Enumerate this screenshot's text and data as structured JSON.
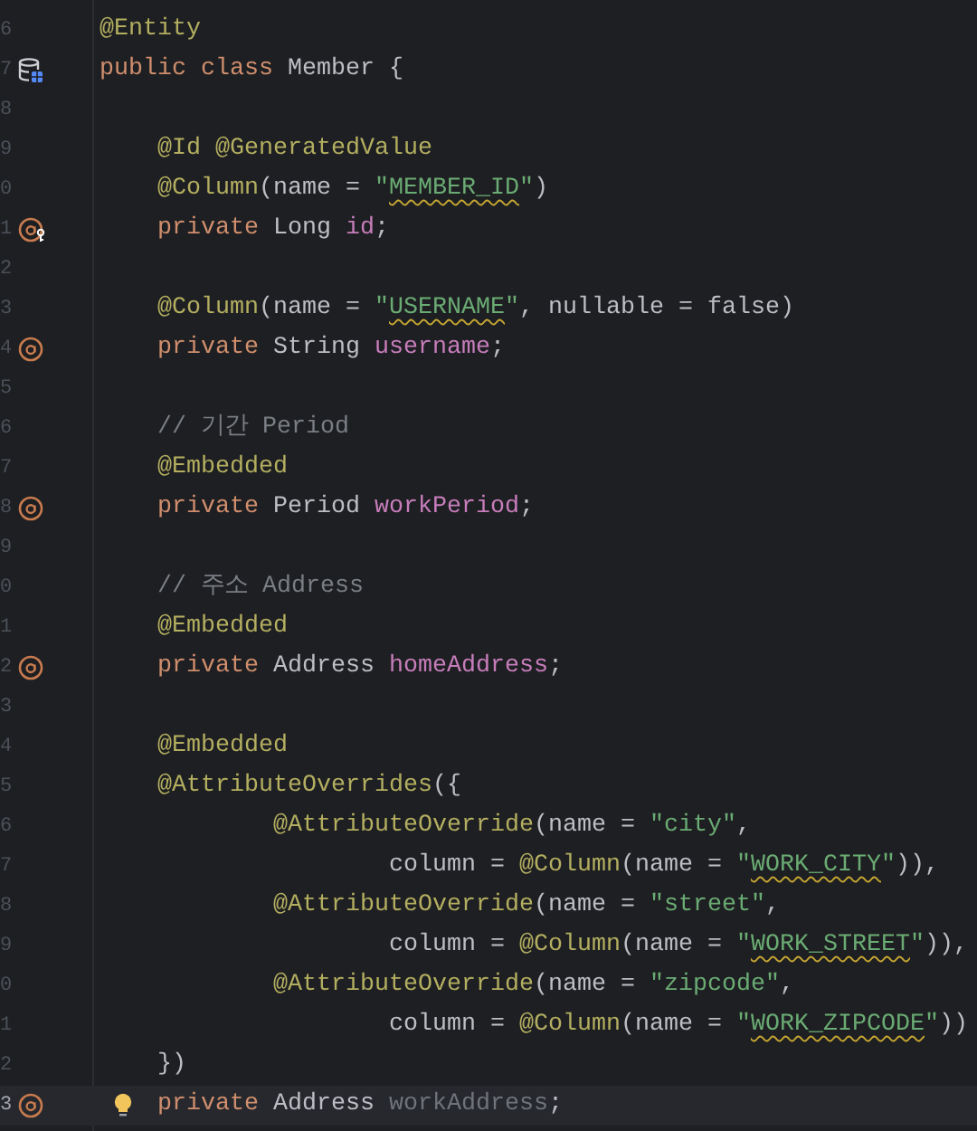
{
  "editor": {
    "lines": [
      {
        "number": "6",
        "kind": "top",
        "tokens": [
          {
            "kind": "annotation",
            "text": "@Entity"
          }
        ]
      },
      {
        "number": "7",
        "kind": "top",
        "gutter_marker": {
          "kind": "entity"
        },
        "tokens": [
          {
            "kind": "keyword",
            "text": "public class "
          },
          {
            "kind": "plain",
            "text": "Member {"
          }
        ]
      },
      {
        "number": "8",
        "kind": "blank"
      },
      {
        "number": "9",
        "kind": "member",
        "tokens": [
          {
            "kind": "annotation",
            "text": "@Id @GeneratedValue"
          }
        ]
      },
      {
        "number": "0",
        "kind": "member",
        "tokens": [
          {
            "kind": "annotation",
            "text": "@Column"
          },
          {
            "kind": "plain",
            "text": "(name = "
          },
          {
            "kind": "string",
            "text": "\""
          },
          {
            "kind": "string_warning",
            "text": "MEMBER_ID"
          },
          {
            "kind": "string",
            "text": "\""
          },
          {
            "kind": "plain",
            "text": ")"
          }
        ]
      },
      {
        "number": "1",
        "kind": "member",
        "gutter_marker": {
          "kind": "id_field"
        },
        "tokens": [
          {
            "kind": "keyword",
            "text": "private "
          },
          {
            "kind": "plain",
            "text": "Long "
          },
          {
            "kind": "field",
            "text": "id"
          },
          {
            "kind": "plain",
            "text": ";"
          }
        ]
      },
      {
        "number": "2",
        "kind": "blank"
      },
      {
        "number": "3",
        "kind": "member",
        "tokens": [
          {
            "kind": "annotation",
            "text": "@Column"
          },
          {
            "kind": "plain",
            "text": "(name = "
          },
          {
            "kind": "string",
            "text": "\""
          },
          {
            "kind": "string_warning",
            "text": "USERNAME"
          },
          {
            "kind": "string",
            "text": "\""
          },
          {
            "kind": "plain",
            "text": ", nullable = false)"
          }
        ]
      },
      {
        "number": "4",
        "kind": "member",
        "gutter_marker": {
          "kind": "field"
        },
        "tokens": [
          {
            "kind": "keyword",
            "text": "private "
          },
          {
            "kind": "plain",
            "text": "String "
          },
          {
            "kind": "field",
            "text": "username"
          },
          {
            "kind": "plain",
            "text": ";"
          }
        ]
      },
      {
        "number": "5",
        "kind": "blank"
      },
      {
        "number": "6",
        "kind": "member",
        "tokens": [
          {
            "kind": "comment",
            "text": "// 기간 Period"
          }
        ]
      },
      {
        "number": "7",
        "kind": "member",
        "tokens": [
          {
            "kind": "annotation",
            "text": "@Embedded"
          }
        ]
      },
      {
        "number": "8",
        "kind": "member",
        "gutter_marker": {
          "kind": "field"
        },
        "tokens": [
          {
            "kind": "keyword",
            "text": "private "
          },
          {
            "kind": "plain",
            "text": "Period "
          },
          {
            "kind": "field",
            "text": "workPeriod"
          },
          {
            "kind": "plain",
            "text": ";"
          }
        ]
      },
      {
        "number": "9",
        "kind": "blank"
      },
      {
        "number": "0",
        "kind": "member",
        "tokens": [
          {
            "kind": "comment",
            "text": "// 주소 Address"
          }
        ]
      },
      {
        "number": "1",
        "kind": "member",
        "tokens": [
          {
            "kind": "annotation",
            "text": "@Embedded"
          }
        ]
      },
      {
        "number": "2",
        "kind": "member",
        "gutter_marker": {
          "kind": "field"
        },
        "tokens": [
          {
            "kind": "keyword",
            "text": "private "
          },
          {
            "kind": "plain",
            "text": "Address "
          },
          {
            "kind": "field",
            "text": "homeAddress"
          },
          {
            "kind": "plain",
            "text": ";"
          }
        ]
      },
      {
        "number": "3",
        "kind": "blank"
      },
      {
        "number": "4",
        "kind": "member",
        "tokens": [
          {
            "kind": "annotation",
            "text": "@Embedded"
          }
        ]
      },
      {
        "number": "5",
        "kind": "member",
        "tokens": [
          {
            "kind": "annotation",
            "text": "@AttributeOverrides"
          },
          {
            "kind": "plain",
            "text": "({"
          }
        ]
      },
      {
        "number": "6",
        "kind": "argument",
        "tokens": [
          {
            "kind": "annotation",
            "text": "@AttributeOverride"
          },
          {
            "kind": "plain",
            "text": "(name = "
          },
          {
            "kind": "string",
            "text": "\"city\""
          },
          {
            "kind": "plain",
            "text": ","
          }
        ]
      },
      {
        "number": "7",
        "kind": "continuation",
        "tokens": [
          {
            "kind": "plain",
            "text": "column = "
          },
          {
            "kind": "annotation",
            "text": "@Column"
          },
          {
            "kind": "plain",
            "text": "(name = "
          },
          {
            "kind": "string",
            "text": "\""
          },
          {
            "kind": "string_warning",
            "text": "WORK_CITY"
          },
          {
            "kind": "string",
            "text": "\""
          },
          {
            "kind": "plain",
            "text": ")),"
          }
        ]
      },
      {
        "number": "8",
        "kind": "argument",
        "tokens": [
          {
            "kind": "annotation",
            "text": "@AttributeOverride"
          },
          {
            "kind": "plain",
            "text": "(name = "
          },
          {
            "kind": "string",
            "text": "\"street\""
          },
          {
            "kind": "plain",
            "text": ","
          }
        ]
      },
      {
        "number": "9",
        "kind": "continuation",
        "tokens": [
          {
            "kind": "plain",
            "text": "column = "
          },
          {
            "kind": "annotation",
            "text": "@Column"
          },
          {
            "kind": "plain",
            "text": "(name = "
          },
          {
            "kind": "string",
            "text": "\""
          },
          {
            "kind": "string_warning",
            "text": "WORK_STREET"
          },
          {
            "kind": "string",
            "text": "\""
          },
          {
            "kind": "plain",
            "text": ")),"
          }
        ]
      },
      {
        "number": "0",
        "kind": "argument",
        "tokens": [
          {
            "kind": "annotation",
            "text": "@AttributeOverride"
          },
          {
            "kind": "plain",
            "text": "(name = "
          },
          {
            "kind": "string",
            "text": "\"zipcode\""
          },
          {
            "kind": "plain",
            "text": ","
          }
        ]
      },
      {
        "number": "1",
        "kind": "continuation",
        "tokens": [
          {
            "kind": "plain",
            "text": "column = "
          },
          {
            "kind": "annotation",
            "text": "@Column"
          },
          {
            "kind": "plain",
            "text": "(name = "
          },
          {
            "kind": "string",
            "text": "\""
          },
          {
            "kind": "string_warning",
            "text": "WORK_ZIPCODE"
          },
          {
            "kind": "string",
            "text": "\""
          },
          {
            "kind": "plain",
            "text": "))"
          }
        ]
      },
      {
        "number": "2",
        "kind": "member",
        "tokens": [
          {
            "kind": "plain",
            "text": "})"
          }
        ]
      },
      {
        "number": "3",
        "kind": "member",
        "gutter_marker": {
          "kind": "field"
        },
        "current": true,
        "bulb": true,
        "tokens": [
          {
            "kind": "keyword",
            "text": "private "
          },
          {
            "kind": "plain",
            "text": "Address "
          },
          {
            "kind": "unused",
            "text": "workAddress"
          },
          {
            "kind": "plain",
            "text": ";"
          }
        ]
      }
    ]
  }
}
